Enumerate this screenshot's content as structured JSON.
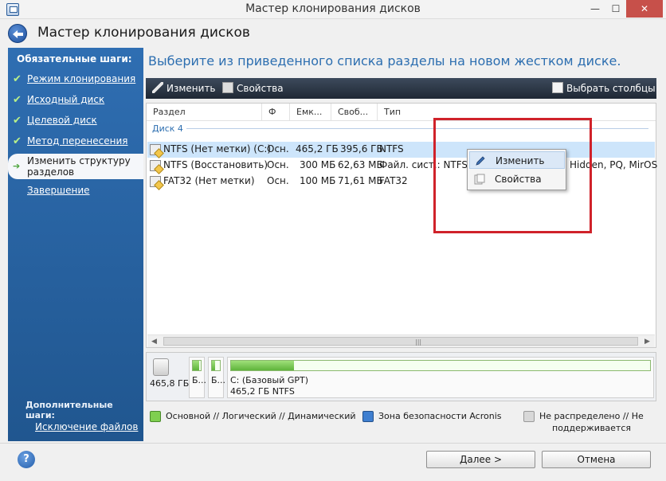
{
  "window": {
    "title": "Мастер клонирования дисков",
    "min": "—",
    "max": "☐",
    "close": "✕"
  },
  "header": {
    "title": "Мастер клонирования дисков"
  },
  "sidebar": {
    "required_heading": "Обязательные шаги:",
    "items": [
      {
        "label": "Режим клонирования",
        "done": true
      },
      {
        "label": "Исходный диск",
        "done": true
      },
      {
        "label": "Целевой диск",
        "done": true
      },
      {
        "label": "Метод перенесения",
        "done": true
      },
      {
        "label": "Изменить структуру разделов",
        "active": true
      },
      {
        "label": "Завершение"
      }
    ],
    "check_glyph": "✔",
    "arrow_glyph": "➔",
    "extra_heading": "Дополнительные шаги:",
    "extra_items": [
      {
        "label": "Исключение файлов"
      }
    ]
  },
  "main": {
    "title": "Выберите из приведенного списка разделы на новом жестком диске.",
    "toolbar": {
      "edit": "Изменить",
      "properties": "Свойства",
      "choose_columns": "Выбрать столбцы"
    },
    "columns": [
      "Раздел",
      "Ф",
      "Емк...",
      "Своб...",
      "Тип"
    ],
    "group": "Диск 4",
    "rows": [
      {
        "name": "NTFS (Нет метки) (C:)",
        "flag": "Осн.",
        "capacity": "465,2 ГБ",
        "free": "395,6 ГБ",
        "type": "NTFS",
        "selected": true
      },
      {
        "name": "NTFS (Восстановить)",
        "flag": "Осн.",
        "capacity": "300 МБ",
        "free": "62,63 МБ",
        "type": "Файл. сист.: NTFS Pa",
        "type_extra": "Hidden, PQ, MirOS"
      },
      {
        "name": "FAT32 (Нет метки)",
        "flag": "Осн.",
        "capacity": "100 МБ",
        "free": "71,61 МБ",
        "type": "FAT32"
      }
    ],
    "scroll_left": "◀",
    "scroll_right": "▶",
    "scroll_grip": "|||"
  },
  "context_menu": {
    "items": [
      "Изменить",
      "Свойства"
    ]
  },
  "diskmap": {
    "size": "465,8 ГБ",
    "parts": [
      {
        "label": "Б..."
      },
      {
        "label": "Б..."
      },
      {
        "label": "C: (Базовый GPT)",
        "sub": "465,2 ГБ  NTFS",
        "used_fraction": 0.15
      }
    ]
  },
  "legend": {
    "items": [
      {
        "label": "Основной // Логический // Динамический",
        "color": "#7fcf4f"
      },
      {
        "label": "Зона безопасности Acronis",
        "color": "#3f7fd0"
      },
      {
        "label_line1": "Не распределено // Не",
        "label_line2": "поддерживается",
        "color": "#d8d8d8"
      }
    ]
  },
  "footer": {
    "help": "?",
    "next": "Далее >",
    "cancel": "Отмена"
  }
}
